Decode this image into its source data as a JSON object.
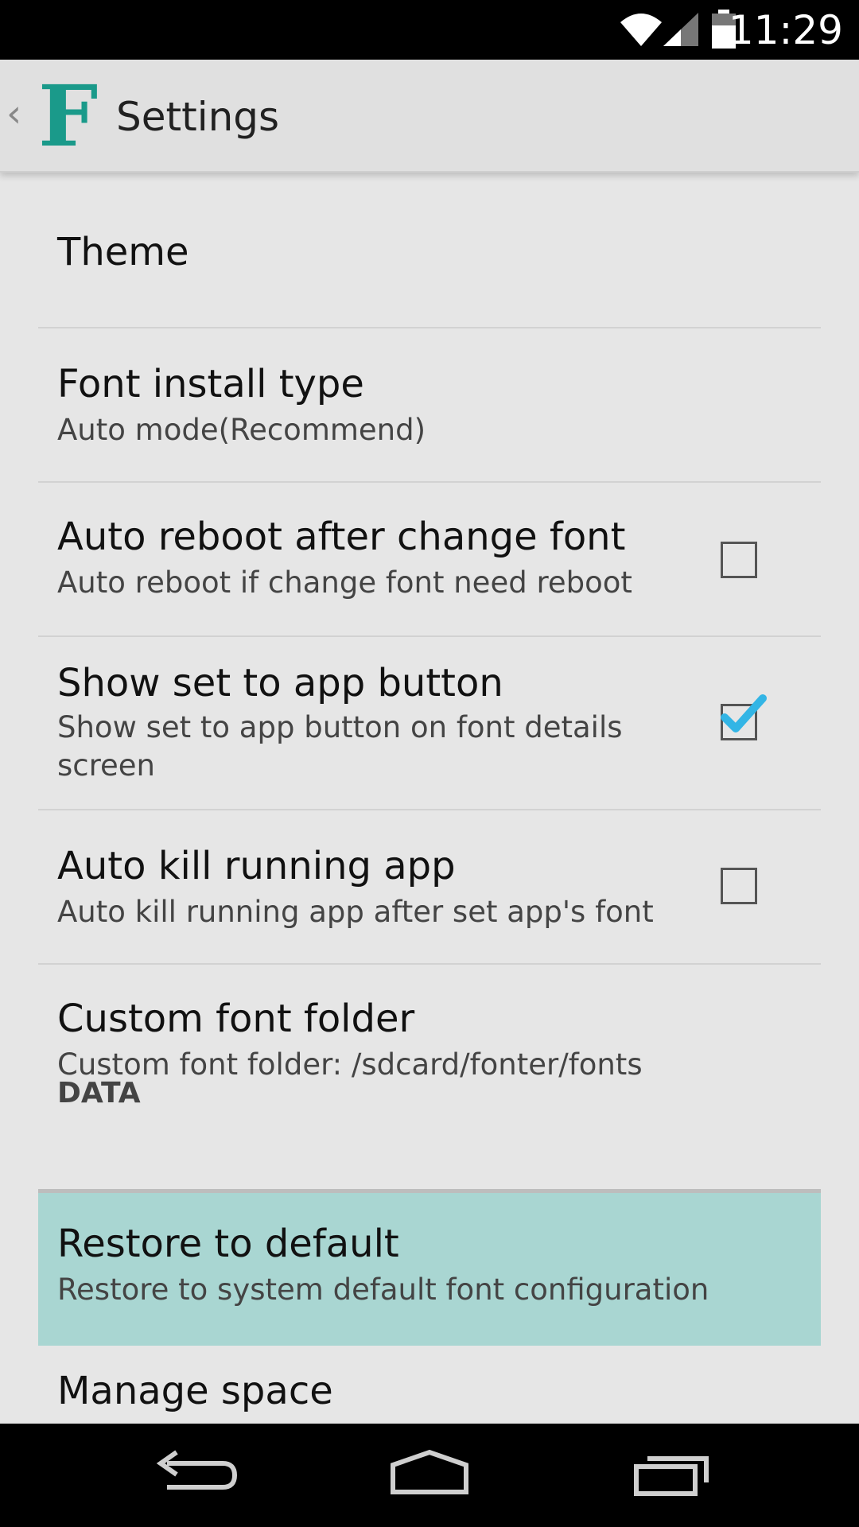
{
  "status_bar": {
    "time": "11:29",
    "icons": [
      "wifi-icon",
      "cell-signal-icon",
      "battery-icon"
    ]
  },
  "action_bar": {
    "title": "Settings",
    "logo_letter": "F",
    "logo_color": "#1a9a8a"
  },
  "preferences": [
    {
      "key": "theme",
      "title": "Theme",
      "summary": ""
    },
    {
      "key": "font_install_type",
      "title": "Font install type",
      "summary": "Auto mode(Recommend)"
    },
    {
      "key": "auto_reboot",
      "title": "Auto reboot after change font",
      "summary": "Auto reboot if change font need reboot",
      "checked": false
    },
    {
      "key": "show_set_to_app",
      "title": "Show set to app button",
      "summary": "Show set to app button on font details screen",
      "checked": true
    },
    {
      "key": "auto_kill",
      "title": "Auto kill running app",
      "summary": "Auto kill running app after set app's font",
      "checked": false
    },
    {
      "key": "custom_font_folder",
      "title": "Custom font folder",
      "summary": "Custom font folder: /sdcard/fonter/fonts"
    }
  ],
  "data_section": {
    "header": "DATA",
    "items": [
      {
        "key": "restore_default",
        "title": "Restore to default",
        "summary": "Restore to system default font configuration",
        "pressed": true
      },
      {
        "key": "manage_space",
        "title": "Manage space",
        "summary": ""
      }
    ]
  },
  "colors": {
    "accent": "#33b5e5",
    "pressed_highlight": "#a9d6d2",
    "background": "#e6e6e6"
  },
  "nav_bar": {
    "buttons": [
      "back-icon",
      "home-icon",
      "recents-icon"
    ]
  }
}
